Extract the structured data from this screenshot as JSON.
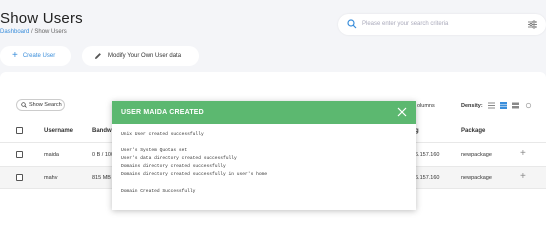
{
  "header": {
    "title": "Show Users",
    "breadcrumb": {
      "link": "Dashboard",
      "separator": " / ",
      "current": "Show Users"
    }
  },
  "search": {
    "placeholder": "Please enter your search criteria",
    "icon": "search-icon",
    "filter_icon": "filter-icon"
  },
  "actions": {
    "create_label": "Create User",
    "modify_label": "Modify Your Own User data"
  },
  "toolbar": {
    "show_search_label": "Show Search",
    "columns_label": "olumns",
    "density_label": "Density:"
  },
  "table": {
    "headers": {
      "username": "Username",
      "bandwidth": "Bandwi",
      "ip": "g",
      "package": "Package"
    },
    "rows": [
      {
        "username": "maida",
        "bandwidth": "0 B / 100",
        "ip": "6.157.160",
        "package": "newpackage"
      },
      {
        "username": "mahv",
        "bandwidth": "815 MB",
        "ip": "6.157.160",
        "package": "newpackage"
      }
    ]
  },
  "modal": {
    "title": "USER MAIDA CREATED",
    "lines": [
      "Unix User created successfully",
      "",
      "User's System Quotas set",
      "User's data directory created successfully",
      "Domains directory created successfully",
      "Domains directory created successfully in user's home",
      "",
      "Domain Created Successfully"
    ]
  },
  "colors": {
    "accent": "#3a8edb",
    "success": "#5cb870",
    "background": "#f4f5f8"
  }
}
